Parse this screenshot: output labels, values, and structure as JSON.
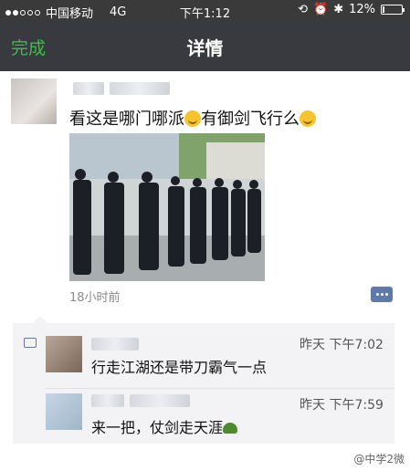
{
  "status_bar": {
    "carrier": "中国移动",
    "network": "4G",
    "time": "下午1:12",
    "battery": "12%",
    "battery_level": 0.12
  },
  "nav": {
    "done_label": "完成",
    "title": "详情"
  },
  "post": {
    "text_part1": "看这是哪门哪派",
    "text_part2": "有御剑飞行么",
    "time_ago": "18小时前"
  },
  "comments": [
    {
      "time": "昨天 下午7:02",
      "text": "行走江湖还是带刀霸气一点"
    },
    {
      "time": "昨天 下午7:59",
      "text": "来一把，仗剑走天涯"
    }
  ],
  "watermark": "@中学2微"
}
